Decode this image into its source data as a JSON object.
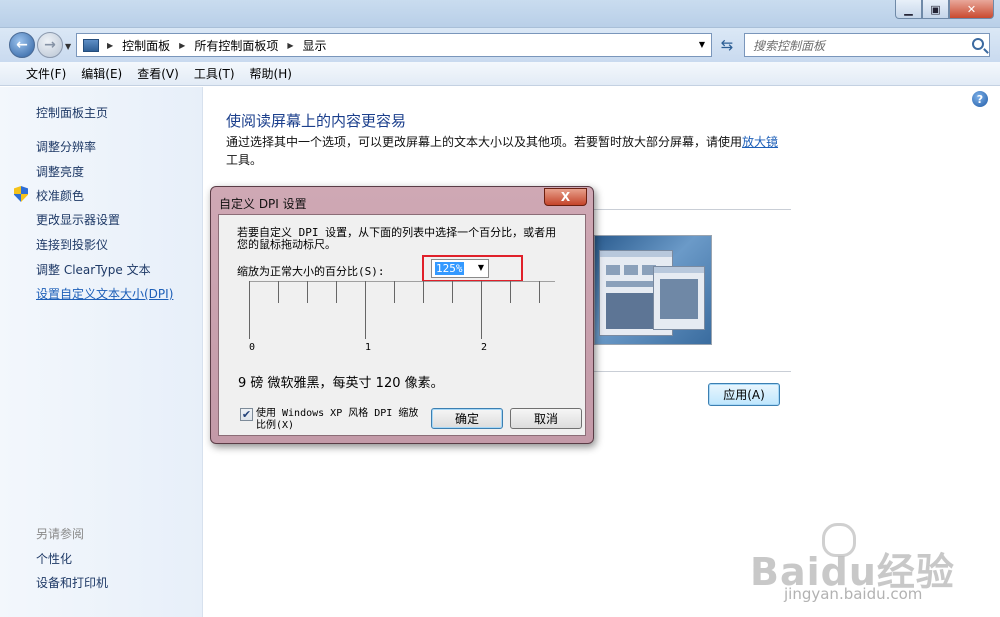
{
  "window": {
    "title": ""
  },
  "address": {
    "crumbs": [
      "控制面板",
      "所有控制面板项",
      "显示"
    ],
    "search_placeholder": "搜索控制面板"
  },
  "menu": [
    "文件(F)",
    "编辑(E)",
    "查看(V)",
    "工具(T)",
    "帮助(H)"
  ],
  "sidebar": {
    "home": "控制面板主页",
    "items": [
      {
        "label": "调整分辨率"
      },
      {
        "label": "调整亮度"
      },
      {
        "label": "校准颜色"
      },
      {
        "label": "更改显示器设置"
      },
      {
        "label": "连接到投影仪"
      },
      {
        "label": "调整 ClearType 文本"
      },
      {
        "label": "设置自定义文本大小(DPI)"
      }
    ],
    "see_also_title": "另请参阅",
    "see_also": [
      "个性化",
      "设备和打印机"
    ]
  },
  "main": {
    "title": "使阅读屏幕上的内容更容易",
    "desc_pre": "通过选择其中一个选项，可以更改屏幕上的文本大小以及其他项。若要暂时放大部分屏幕，请使用",
    "magnifier_link": "放大镜",
    "desc_post": "工具。",
    "apply_label": "应用(A)"
  },
  "dialog": {
    "title": "自定义 DPI 设置",
    "close_label": "X",
    "instruction": "若要自定义 DPI 设置，从下面的列表中选择一个百分比，或者用您的鼠标拖动标尺。",
    "scale_label": "缩放为正常大小的百分比(S):",
    "scale_value": "125%",
    "ruler_numbers": [
      "0",
      "1",
      "2"
    ],
    "sample_text": "9 磅 微软雅黑，每英寸 120 像素。",
    "xp_checkbox_label": "使用 Windows XP 风格 DPI 缩放比例(X)",
    "xp_checked": true,
    "ok_label": "确定",
    "cancel_label": "取消"
  },
  "watermark": {
    "brand": "Baidu经验",
    "url": "jingyan.baidu.com"
  }
}
